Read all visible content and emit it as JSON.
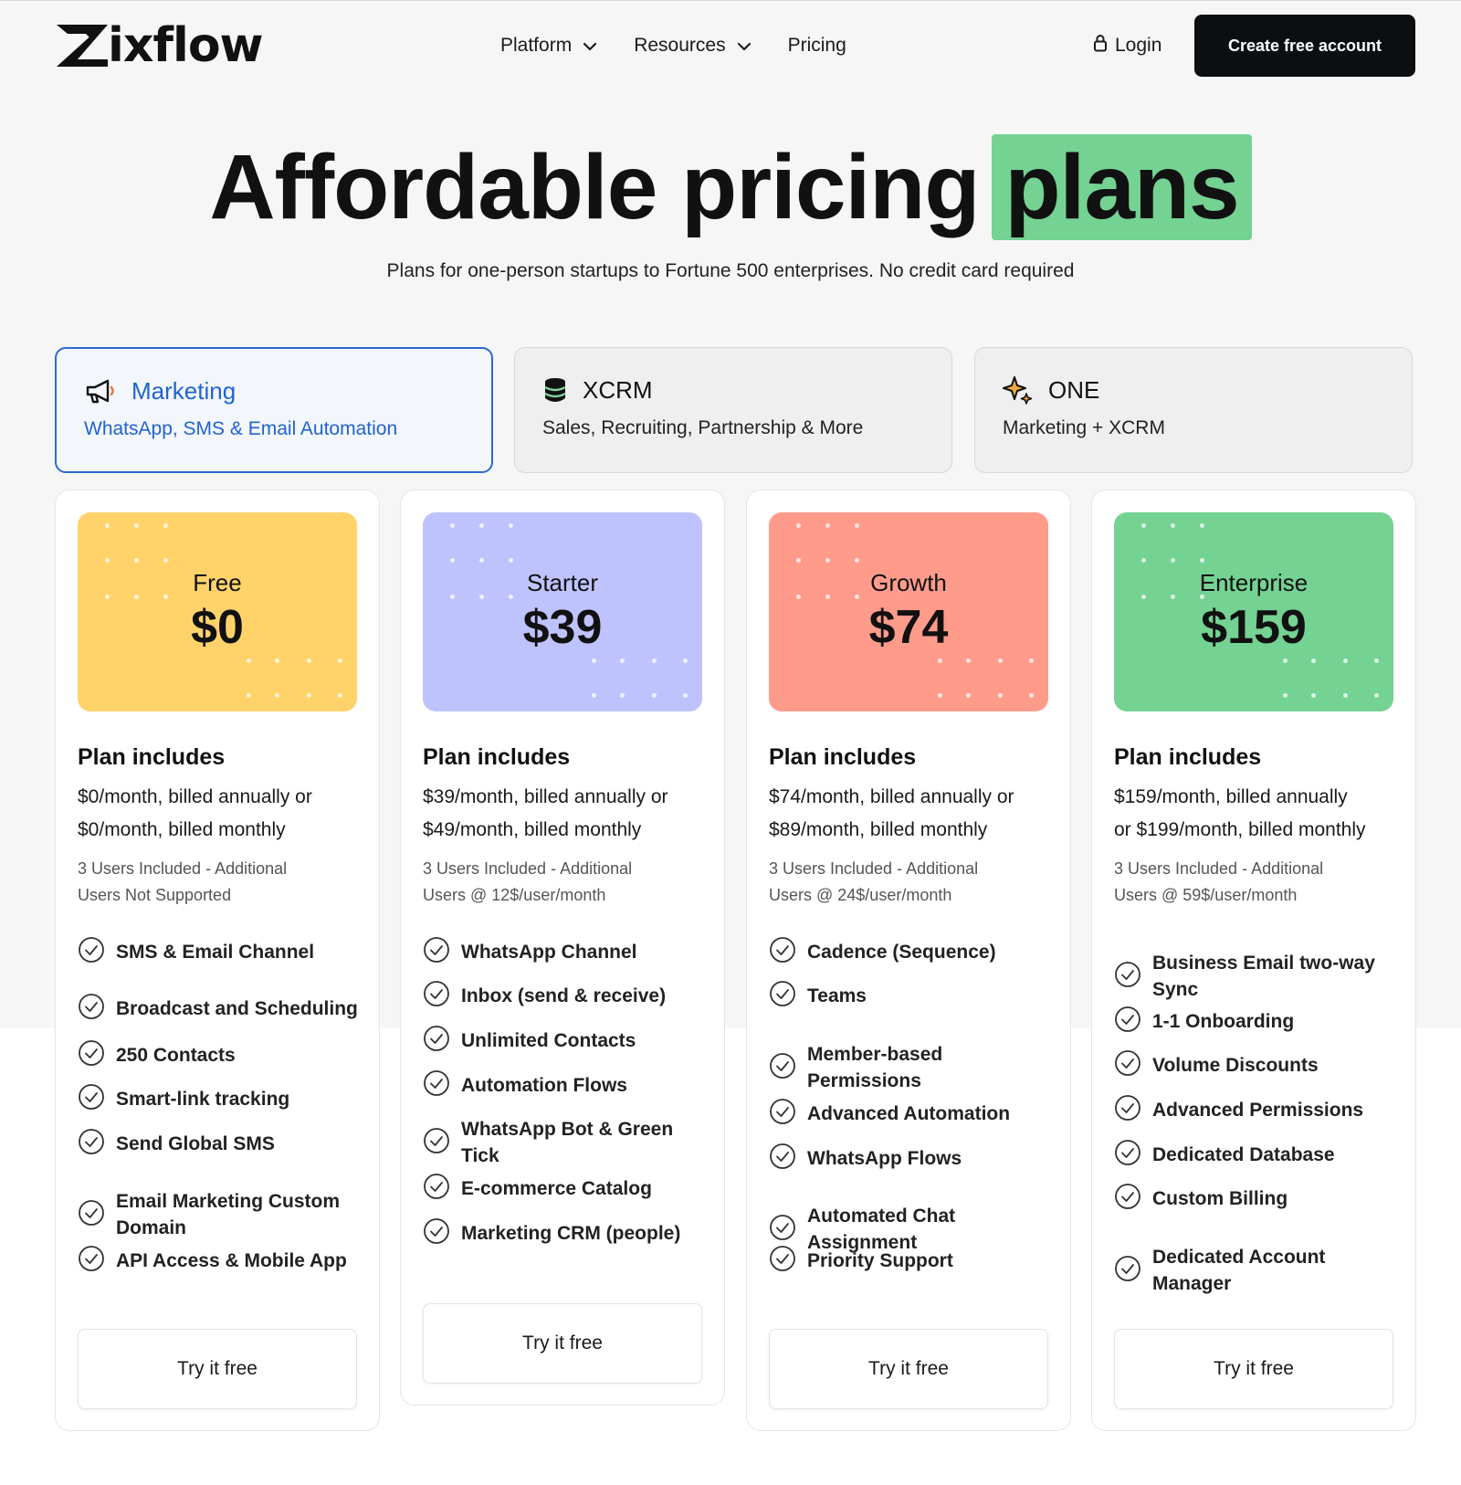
{
  "brand": {
    "name": "ixflow"
  },
  "nav": {
    "items": [
      {
        "label": "Platform"
      },
      {
        "label": "Resources"
      },
      {
        "label": "Pricing"
      }
    ],
    "login": "Login",
    "cta": "Create free account"
  },
  "hero": {
    "title": "Affordable pricing",
    "highlight": "plans",
    "subtitle": "Plans for one-person startups to Fortune 500 enterprises. No credit card required"
  },
  "products": [
    {
      "name": "Marketing",
      "desc": "WhatsApp, SMS & Email Automation",
      "icon": "megaphone-icon",
      "active": true
    },
    {
      "name": "XCRM",
      "desc": "Sales, Recruiting, Partnership & More",
      "icon": "database-icon",
      "active": false
    },
    {
      "name": "ONE",
      "desc": "Marketing + XCRM",
      "icon": "sparkle-icon",
      "active": false
    }
  ],
  "plans": [
    {
      "name": "Free",
      "price": "$0",
      "color": "#ffd36a",
      "includes_title": "Plan includes",
      "billing": [
        "$0/month, billed annually or",
        "$0/month, billed monthly"
      ],
      "users": [
        "3 Users Included - Additional",
        "Users Not Supported"
      ],
      "features": [
        "SMS & Email Channel",
        "Broadcast and Scheduling",
        "250 Contacts",
        "Smart-link tracking",
        "Send Global SMS",
        "Email Marketing Custom Domain",
        "API Access & Mobile App"
      ],
      "cta": "Try it free"
    },
    {
      "name": "Starter",
      "price": "$39",
      "color": "#bec3fd",
      "includes_title": "Plan includes",
      "billing": [
        "$39/month, billed annually or",
        "$49/month, billed monthly"
      ],
      "users": [
        "3 Users Included - Additional",
        "Users @ 12$/user/month"
      ],
      "features": [
        "WhatsApp Channel",
        "Inbox (send & receive)",
        "Unlimited Contacts",
        "Automation Flows",
        "WhatsApp Bot & Green Tick",
        "E-commerce Catalog",
        "Marketing CRM (people)"
      ],
      "cta": "Try it free"
    },
    {
      "name": "Growth",
      "price": "$74",
      "color": "#ff9b8b",
      "includes_title": "Plan includes",
      "billing": [
        "$74/month, billed annually or",
        "$89/month, billed monthly"
      ],
      "users": [
        "3 Users Included - Additional",
        "Users @ 24$/user/month"
      ],
      "features": [
        "Cadence (Sequence)",
        "Teams",
        "Member-based Permissions",
        "Advanced Automation",
        "WhatsApp Flows",
        "Automated Chat Assignment",
        "Priority Support"
      ],
      "cta": "Try it free"
    },
    {
      "name": "Enterprise",
      "price": "$159",
      "color": "#74d293",
      "includes_title": "Plan includes",
      "billing": [
        "$159/month, billed annually",
        "or $199/month, billed monthly"
      ],
      "users": [
        "3 Users Included - Additional",
        "Users @ 59$/user/month"
      ],
      "features": [
        "Business Email two-way Sync",
        "1-1 Onboarding",
        "Volume Discounts",
        "Advanced Permissions",
        "Dedicated Database",
        "Custom Billing",
        "Dedicated Account Manager"
      ],
      "cta": "Try it free"
    }
  ]
}
